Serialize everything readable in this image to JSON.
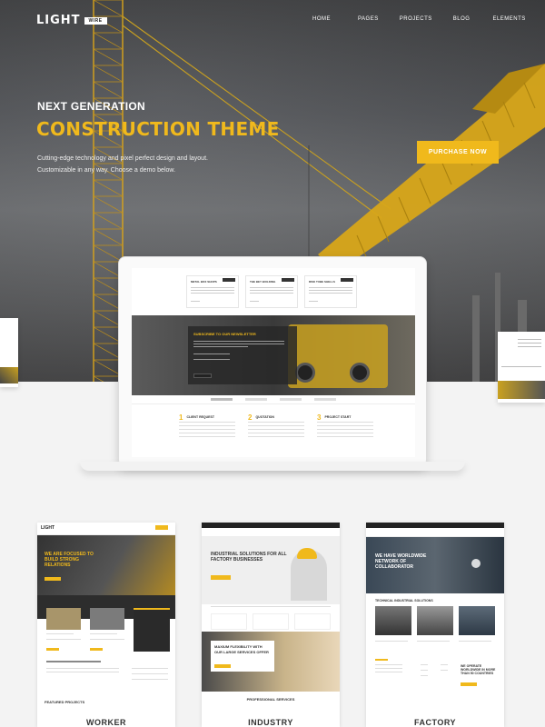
{
  "header": {
    "logo_word": "LIGHT",
    "logo_tag": "WIRE",
    "nav": [
      "HOME",
      "PAGES",
      "PROJECTS",
      "BLOG",
      "ELEMENTS"
    ]
  },
  "hero": {
    "eyebrow": "NEXT GENERATION",
    "title": "CONSTRUCTION THEME",
    "description_line1": "Cutting-edge technology and pixel perfect design and layout.",
    "description_line2": "Customizable in any way. Choose a demo below.",
    "cta_label": "PURCHASE NOW"
  },
  "laptop_preview": {
    "cards": [
      "METAL BOX SHOPS",
      "THE BEY BUILDING",
      "RISK TUBE SHELLS"
    ],
    "newsletter_title": "SUBSCRIBE TO OUR NEWSLETTER",
    "services": [
      {
        "num": "1",
        "title": "CLIENT REQUEST"
      },
      {
        "num": "2",
        "title": "QUOTATION"
      },
      {
        "num": "3",
        "title": "PROJECT START"
      }
    ]
  },
  "demos": [
    {
      "name": "WORKER",
      "headline": "WE ARE FOCUSED TO BUILD STRONG RELATIONS",
      "section": "FEATURED PROJECTS"
    },
    {
      "name": "INDUSTRY",
      "headline": "INDUSTRIAL SOLUTIONS FOR ALL FACTORY BUSINESSES",
      "section": "PROFESSIONAL SERVICES"
    },
    {
      "name": "FACTORY",
      "headline": "WE HAVE WORLDWIDE NETWORK OF COLLABORATOR",
      "section": "TECHNICAL INDUSTRIAL SOLUTIONS"
    }
  ],
  "colors": {
    "accent": "#f0b91c",
    "dark": "#333333"
  }
}
